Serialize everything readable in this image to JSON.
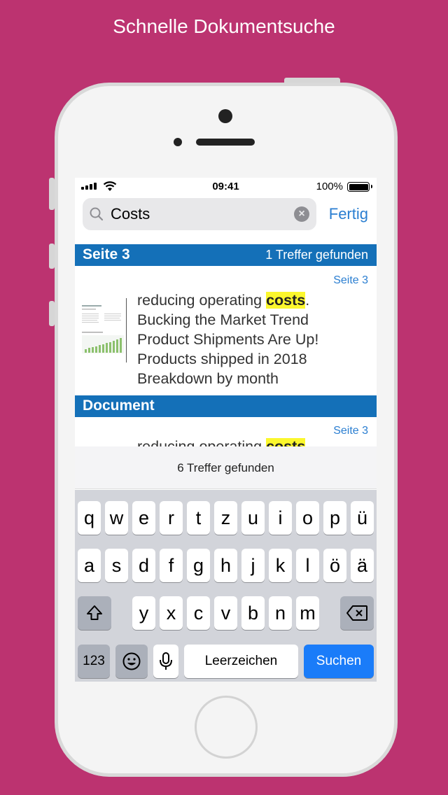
{
  "headline": "Schnelle Dokumentsuche",
  "status_bar": {
    "time": "09:41",
    "battery_percent": "100%",
    "signal_icon": "cellular-signal-icon",
    "wifi_icon": "wifi-icon",
    "battery_icon": "battery-full-icon"
  },
  "search": {
    "value": "Costs",
    "placeholder": "",
    "done_label": "Fertig",
    "clear_icon": "×"
  },
  "sections": [
    {
      "title": "Seite 3",
      "count_label": "1 Treffer gefunden",
      "result": {
        "page_label": "Seite 3",
        "text_before": "reducing operating ",
        "highlight": "costs",
        "text_after": ".\nBucking the Market Trend\nProduct Shipments Are Up!\nProducts shipped in 2018\nBreakdown by month"
      }
    },
    {
      "title": "Document",
      "count_label": "",
      "result": {
        "page_label": "Seite 3",
        "text_before": "reducing operating ",
        "highlight": "costs",
        "text_after": "."
      }
    }
  ],
  "found_summary": "6 Treffer gefunden",
  "keyboard": {
    "row1": [
      "q",
      "w",
      "e",
      "r",
      "t",
      "z",
      "u",
      "i",
      "o",
      "p",
      "ü"
    ],
    "row2": [
      "a",
      "s",
      "d",
      "f",
      "g",
      "h",
      "j",
      "k",
      "l",
      "ö",
      "ä"
    ],
    "row3": [
      "y",
      "x",
      "c",
      "v",
      "b",
      "n",
      "m"
    ],
    "numbers_label": "123",
    "space_label": "Leerzeichen",
    "search_label": "Suchen",
    "shift_icon": "shift-icon",
    "delete_icon": "delete-icon",
    "emoji_icon": "emoji-icon",
    "mic_icon": "microphone-icon"
  },
  "colors": {
    "background": "#bc3370",
    "section_header": "#1470b8",
    "accent": "#2a7ed1",
    "highlight": "#fbf72d",
    "search_key": "#1a7cf9"
  }
}
